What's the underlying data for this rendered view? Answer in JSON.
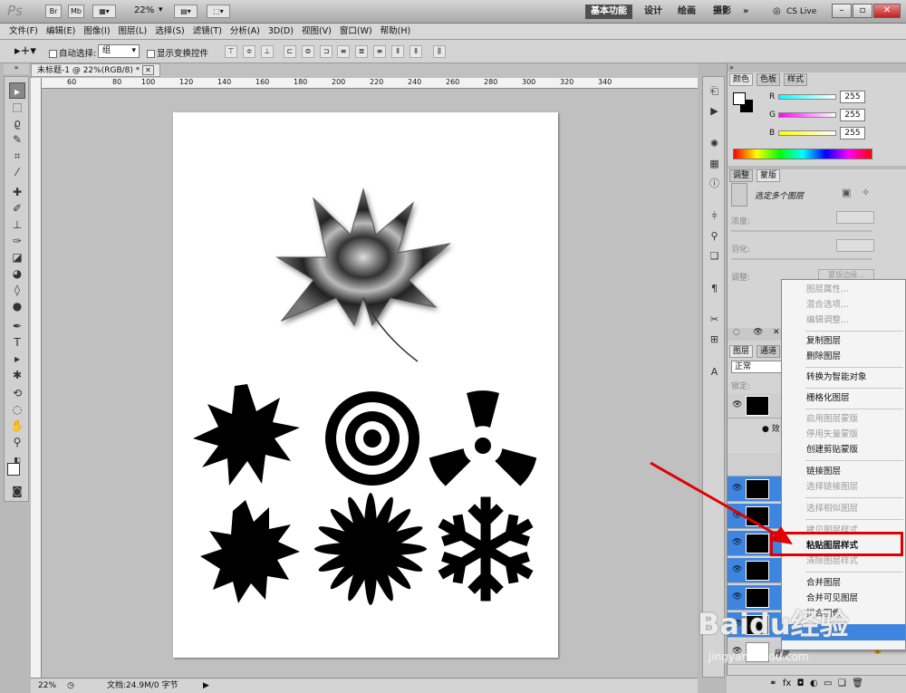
{
  "app": {
    "logo": "Ps",
    "mini_br": "Br",
    "mini_mb": "Mb",
    "zoom": "22%",
    "workspaces": [
      "基本功能",
      "设计",
      "绘画",
      "摄影"
    ],
    "more": "»",
    "cslive": "CS Live"
  },
  "menu": [
    "文件(F)",
    "编辑(E)",
    "图像(I)",
    "图层(L)",
    "选择(S)",
    "滤镜(T)",
    "分析(A)",
    "3D(D)",
    "视图(V)",
    "窗口(W)",
    "帮助(H)"
  ],
  "options": {
    "auto_select": "自动选择:",
    "group": "组",
    "show_transform": "显示变换控件"
  },
  "document": {
    "tab": "未标题-1 @ 22%(RGB/8) *",
    "status_zoom": "22%",
    "status_doc": "文档:24.9M/0 字节",
    "ruler_h": [
      "60",
      "80",
      "100",
      "120",
      "140",
      "160",
      "180",
      "200",
      "220",
      "240",
      "260",
      "280",
      "300",
      "320",
      "340"
    ]
  },
  "panels": {
    "color_tabs": [
      "颜色",
      "色板",
      "样式"
    ],
    "rgb": [
      {
        "label": "R",
        "value": "255",
        "gradient": "linear-gradient(90deg,#0ff,#fff)"
      },
      {
        "label": "G",
        "value": "255",
        "gradient": "linear-gradient(90deg,#f0f,#fff)"
      },
      {
        "label": "B",
        "value": "255",
        "gradient": "linear-gradient(90deg,#ff0,#fff)"
      }
    ],
    "adj_tabs": [
      "调整",
      "蒙版"
    ],
    "mask_title": "选定多个图层",
    "density": "浓度:",
    "feather": "羽化:",
    "refine": "调整:",
    "edge_btn": "蒙版边缘...",
    "layer_tabs": [
      "图层",
      "通道"
    ],
    "blend_mode": "正常",
    "lock": "锁定:",
    "effects_label": "效",
    "bg_label": "背景"
  },
  "context_menu": [
    {
      "label": "图层属性...",
      "disabled": true
    },
    {
      "label": "混合选项...",
      "disabled": true
    },
    {
      "label": "编辑调整...",
      "disabled": true
    },
    {
      "label": "复制图层",
      "disabled": false
    },
    {
      "label": "删除图层",
      "disabled": false
    },
    {
      "label": "转换为智能对象",
      "disabled": false
    },
    {
      "label": "栅格化图层",
      "disabled": false
    },
    {
      "label": "启用图层蒙版",
      "disabled": true
    },
    {
      "label": "停用矢量蒙版",
      "disabled": true
    },
    {
      "label": "创建剪贴蒙版",
      "disabled": false
    },
    {
      "label": "链接图层",
      "disabled": false
    },
    {
      "label": "选择链接图层",
      "disabled": true
    },
    {
      "label": "选择相似图层",
      "disabled": true
    },
    {
      "label": "拷贝图层样式",
      "disabled": true
    },
    {
      "label": "粘贴图层样式",
      "disabled": false,
      "highlight": true
    },
    {
      "label": "清除图层样式",
      "disabled": true
    },
    {
      "label": "合并图层",
      "disabled": false
    },
    {
      "label": "合并可见图层",
      "disabled": false
    },
    {
      "label": "拼合图像",
      "disabled": false
    }
  ],
  "watermark": {
    "brand": "Baidu经验",
    "url": "jingyan.baidu.com"
  },
  "colors": {
    "highlight": "#3e85e0",
    "annotation": "#e10000"
  }
}
